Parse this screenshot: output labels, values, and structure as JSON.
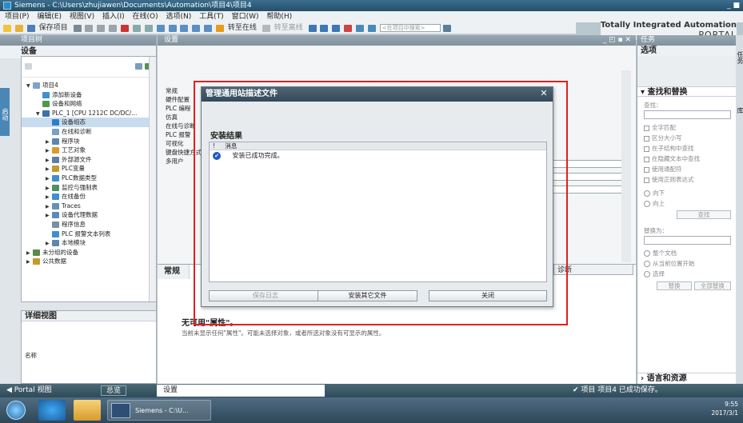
{
  "window": {
    "title": "Siemens  -  C:\\Users\\zhujiawen\\Documents\\Automation\\项目4\\项目4",
    "controls": "_ ■"
  },
  "menu": [
    "项目(P)",
    "编辑(E)",
    "视图(V)",
    "插入(I)",
    "在线(O)",
    "选项(N)",
    "工具(T)",
    "窗口(W)",
    "帮助(H)"
  ],
  "toolbar": {
    "save_label": "保存项目",
    "go_online": "转至在线",
    "go_offline": "转至离线",
    "search_placeholder": "<在项目中搜索>"
  },
  "brand": {
    "line1": "Totally Integrated Automation",
    "line2": "PORTAL"
  },
  "project_tree": {
    "header": "项目树",
    "tab": "设备",
    "side_tab": "启动",
    "items": [
      {
        "label": "项目4",
        "level": 0,
        "arrow": "▼"
      },
      {
        "label": "添加新设备",
        "level": 1,
        "arrow": ""
      },
      {
        "label": "设备和网络",
        "level": 1,
        "arrow": ""
      },
      {
        "label": "PLC_1 [CPU 1212C DC/DC/...",
        "level": 1,
        "arrow": "▼"
      },
      {
        "label": "设备组态",
        "level": 2,
        "arrow": ""
      },
      {
        "label": "在线和诊断",
        "level": 2,
        "arrow": ""
      },
      {
        "label": "程序块",
        "level": 2,
        "arrow": "▶"
      },
      {
        "label": "工艺对象",
        "level": 2,
        "arrow": "▶"
      },
      {
        "label": "外部源文件",
        "level": 2,
        "arrow": "▶"
      },
      {
        "label": "PLC变量",
        "level": 2,
        "arrow": "▶"
      },
      {
        "label": "PLC数据类型",
        "level": 2,
        "arrow": "▶"
      },
      {
        "label": "监控与强制表",
        "level": 2,
        "arrow": "▶"
      },
      {
        "label": "在线备份",
        "level": 2,
        "arrow": "▶"
      },
      {
        "label": "Traces",
        "level": 2,
        "arrow": "▶"
      },
      {
        "label": "设备代理数据",
        "level": 2,
        "arrow": "▶"
      },
      {
        "label": "程序信息",
        "level": 2,
        "arrow": ""
      },
      {
        "label": "PLC 报警文本列表",
        "level": 2,
        "arrow": ""
      },
      {
        "label": "本地模块",
        "level": 2,
        "arrow": "▶"
      },
      {
        "label": "未分组的设备",
        "level": 0,
        "arrow": "▶"
      },
      {
        "label": "公共数据",
        "level": 0,
        "arrow": "▶"
      }
    ],
    "detail_view": "详细视图",
    "name_col": "名称"
  },
  "settings": {
    "header": "设置",
    "nav": [
      "常规",
      "硬件配置",
      "PLC 编程",
      "仿真",
      "在线与诊断",
      "PLC 报警",
      "可视化",
      "键盘快捷方式",
      "多用户"
    ],
    "inspector_tab": "常规",
    "diag_tab": "诊断",
    "no_props": "无可用\"属性\"。",
    "no_props_hint": "当前未显示任何\"属性\"。可能未选择对象，或者所选对象没有可显示的属性。"
  },
  "dialog": {
    "title": "管理通用站描述文件",
    "close": "✕",
    "section": "安装结果",
    "col_message": "消息",
    "row_index": "!",
    "message": "安装已成功完成。",
    "btn_save_log": "保存日志",
    "btn_install_other": "安装其它文件",
    "btn_close": "关闭"
  },
  "tasks": {
    "header": "任务",
    "options": "选项",
    "find_replace": "查找和替换",
    "find_label": "查找：",
    "checks": [
      "全字匹配",
      "区分大小写",
      "在子结构中查找",
      "在隐藏文本中查找",
      "使用通配符",
      "使用正则表达式"
    ],
    "dir_down": "向下",
    "dir_up": "向上",
    "find_btn": "查找",
    "replace_label": "替换为：",
    "scopes": [
      "整个文档",
      "从当前位置开始",
      "选择"
    ],
    "replace_btn": "替换",
    "replace_all_btn": "全部替换",
    "lang_res": "语言和资源",
    "side_tabs": [
      "任务",
      "库"
    ]
  },
  "portal": {
    "view": "Portal 视图",
    "overview": "总览",
    "settings": "设置",
    "status": "项目 项目4 已成功保存。"
  },
  "taskbar": {
    "app_label": "Siemens - C:\\U...",
    "time": "9:55",
    "date": "2017/3/1"
  },
  "colors": {
    "highlight_box": "#e02020",
    "title_bar": "#34495a",
    "ok_icon": "#1f5bc4"
  }
}
